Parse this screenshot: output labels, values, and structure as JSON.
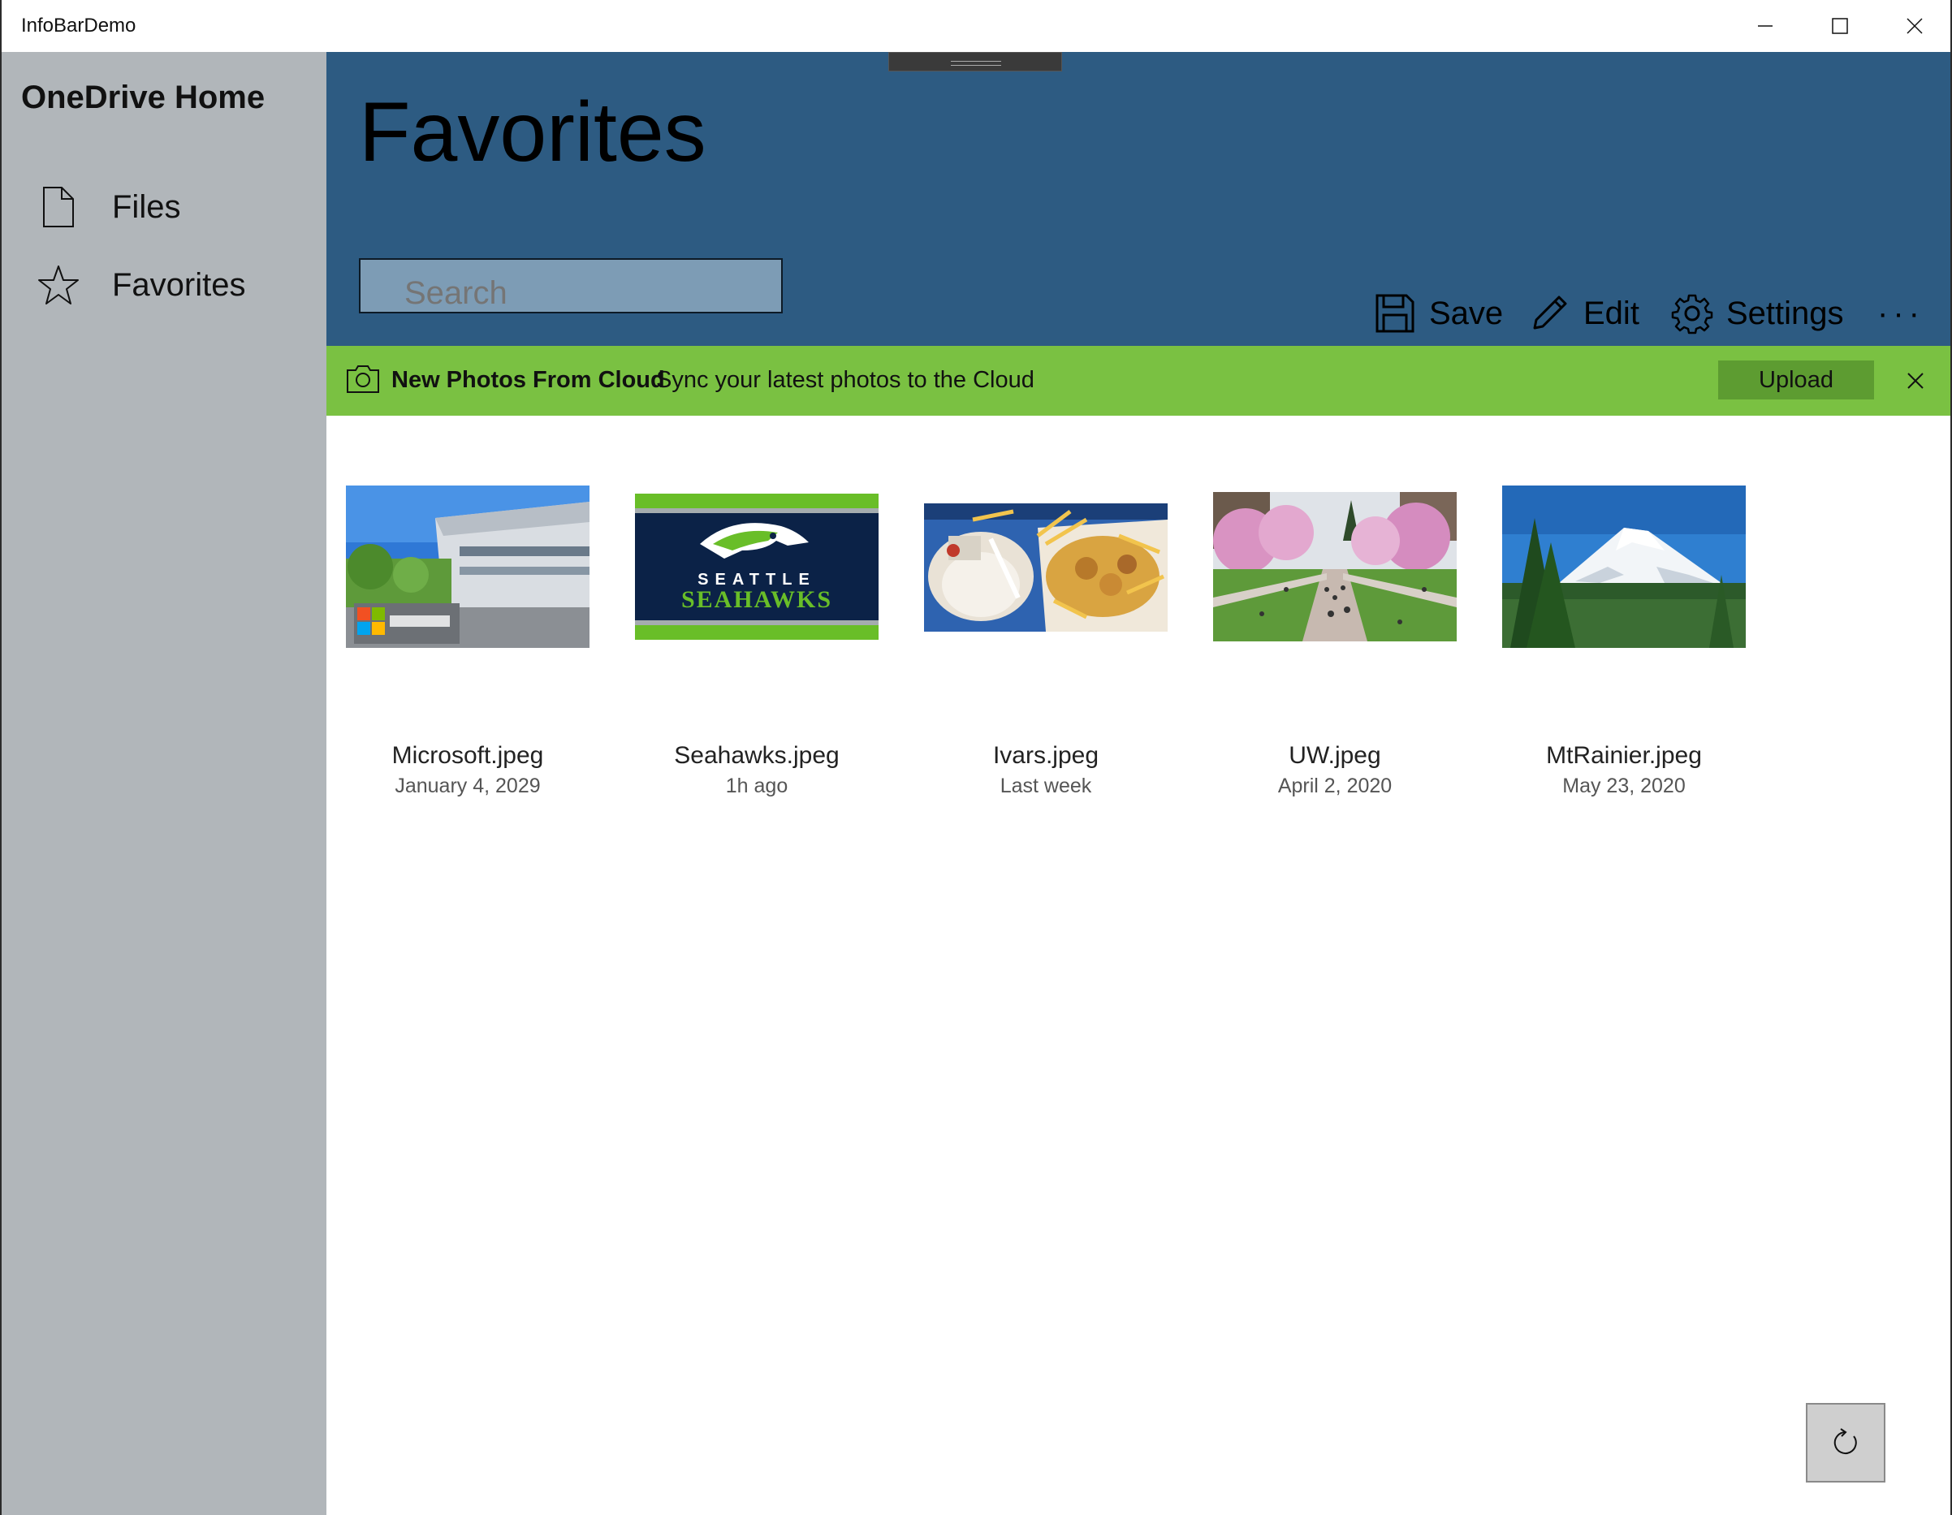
{
  "window": {
    "title": "InfoBarDemo"
  },
  "sidebar": {
    "brand": "OneDrive Home",
    "items": [
      {
        "label": "Files",
        "icon": "document-icon"
      },
      {
        "label": "Favorites",
        "icon": "star-icon"
      }
    ]
  },
  "header": {
    "title": "Favorites",
    "search_placeholder": "Search",
    "commands": [
      {
        "label": "Save",
        "icon": "save-icon"
      },
      {
        "label": "Edit",
        "icon": "pencil-icon"
      },
      {
        "label": "Settings",
        "icon": "gear-icon"
      }
    ],
    "more": "···"
  },
  "infobar": {
    "title": "New Photos From Cloud",
    "message": "Sync your latest photos to the Cloud",
    "action": "Upload",
    "color": "#7ac142"
  },
  "photos": [
    {
      "name": "Microsoft.jpeg",
      "date": "January 4, 2029"
    },
    {
      "name": "Seahawks.jpeg",
      "date": "1h ago",
      "logo_top": "SEATTLE",
      "logo_bottom": "SEAHAWKS"
    },
    {
      "name": "Ivars.jpeg",
      "date": "Last week"
    },
    {
      "name": "UW.jpeg",
      "date": "April 2, 2020"
    },
    {
      "name": "MtRainier.jpeg",
      "date": "May 23, 2020"
    }
  ],
  "colors": {
    "header": "#2d5b82",
    "sidebar": "#b1b6ba",
    "infobar": "#7ac142",
    "upload_button": "#5d9c31"
  }
}
